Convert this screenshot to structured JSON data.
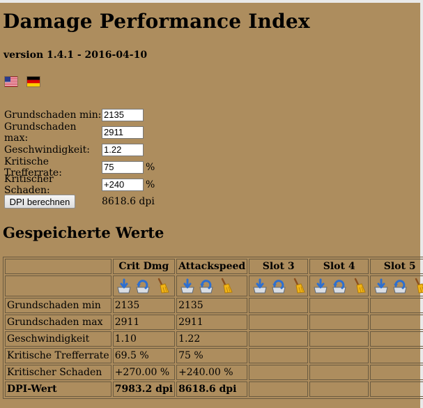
{
  "page": {
    "title": "Damage Performance Index",
    "version": "version 1.4.1 - 2016-04-10"
  },
  "languages": [
    {
      "icon": "us-flag-icon"
    },
    {
      "icon": "de-flag-icon"
    }
  ],
  "form": {
    "fields": [
      {
        "label": "Grundschaden min:",
        "value": "2135",
        "unit": ""
      },
      {
        "label": "Grundschaden max:",
        "value": "2911",
        "unit": ""
      },
      {
        "label": "Geschwindigkeit:",
        "value": "1.22",
        "unit": ""
      },
      {
        "label": "Kritische Trefferrate:",
        "value": "75",
        "unit": "%"
      },
      {
        "label": "Kritischer Schaden:",
        "value": "+240",
        "unit": "%"
      }
    ],
    "button_label": "DPI berechnen",
    "result": "8618.6 dpi"
  },
  "saved": {
    "heading": "Gespeicherte Werte",
    "columns": [
      "",
      "Crit Dmg",
      "Attackspeed",
      "Slot 3",
      "Slot 4",
      "Slot 5"
    ],
    "slot_icons": [
      "save-icon",
      "load-icon",
      "clear-broom-icon"
    ],
    "rows": [
      {
        "label": "Grundschaden min",
        "values": [
          "2135",
          "2135",
          "",
          "",
          ""
        ]
      },
      {
        "label": "Grundschaden max",
        "values": [
          "2911",
          "2911",
          "",
          "",
          ""
        ]
      },
      {
        "label": "Geschwindigkeit",
        "values": [
          "1.10",
          "1.22",
          "",
          "",
          ""
        ]
      },
      {
        "label": "Kritische Trefferrate",
        "values": [
          "69.5 %",
          "75 %",
          "",
          "",
          ""
        ]
      },
      {
        "label": "Kritischer Schaden",
        "values": [
          "+270.00 %",
          "+240.00 %",
          "",
          "",
          ""
        ]
      },
      {
        "label": "DPI-Wert",
        "values": [
          "7983.2 dpi",
          "8618.6 dpi",
          "",
          "",
          ""
        ]
      }
    ]
  },
  "colors": {
    "background": "#ad8d5e",
    "table_border": "#6a5a40"
  }
}
